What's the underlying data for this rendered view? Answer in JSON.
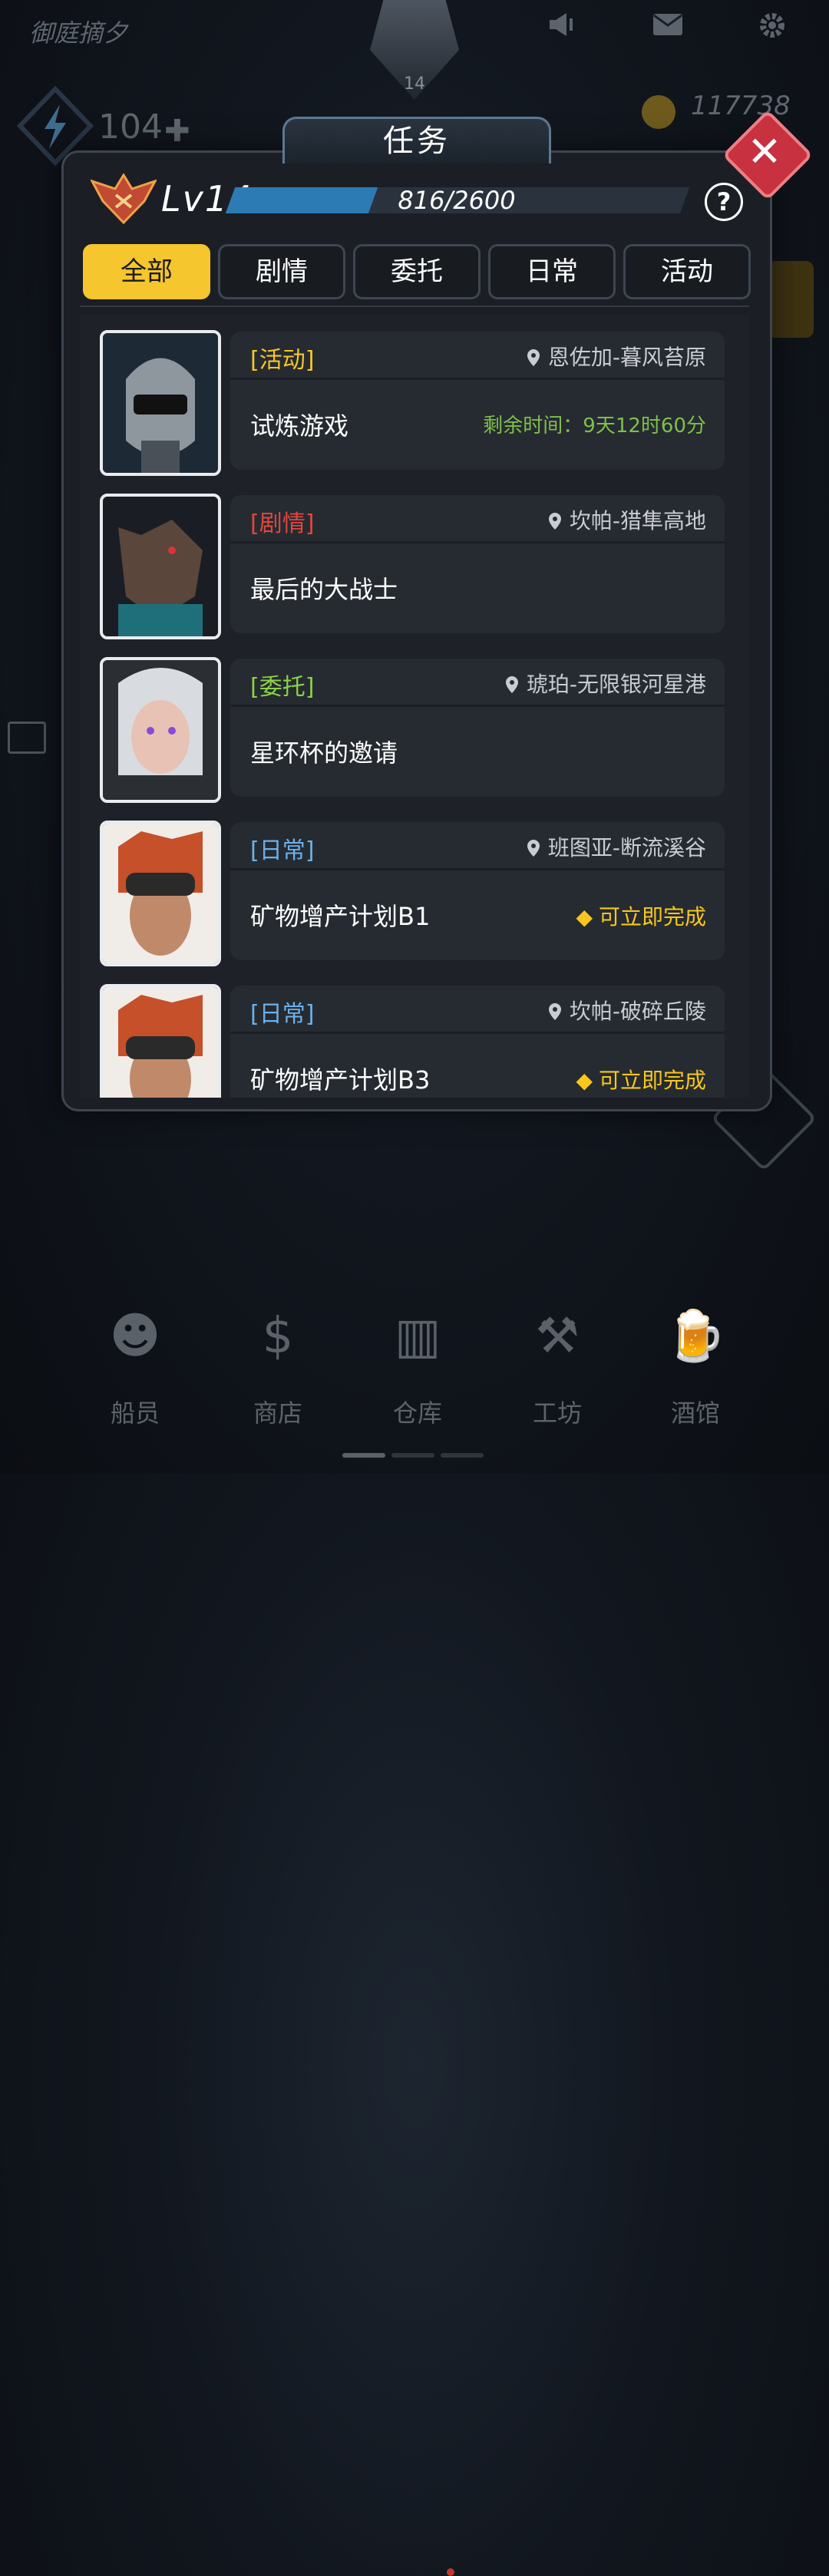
{
  "hud": {
    "player_name": "御庭摘夕",
    "player_level": "14",
    "energy": "104",
    "coins": "117738"
  },
  "panel": {
    "title": "任务",
    "level_label": "Lv14",
    "xp_text": "816/2600",
    "xp_fraction": 0.314,
    "help_label": "?",
    "close_label": "✕"
  },
  "tabs": [
    "全部",
    "剧情",
    "委托",
    "日常",
    "活动"
  ],
  "active_tab": 0,
  "quests": [
    {
      "tag": "[活动]",
      "tag_type": "act",
      "location": "恩佐加-暮风苔原",
      "name": "试炼游戏",
      "side": "剩余时间：9天12时60分",
      "side_type": "timer",
      "portrait": "robot-helmet"
    },
    {
      "tag": "[剧情]",
      "tag_type": "story",
      "location": "坎帕-猎隼高地",
      "name": "最后的大战士",
      "side": "",
      "side_type": "",
      "portrait": "wolf"
    },
    {
      "tag": "[委托]",
      "tag_type": "comm",
      "location": "琥珀-无限银河星港",
      "name": "星环杯的邀请",
      "side": "",
      "side_type": "",
      "portrait": "silver-hair-girl"
    },
    {
      "tag": "[日常]",
      "tag_type": "daily",
      "location": "班图亚-断流溪谷",
      "name": "矿物增产计划B1",
      "side": "可立即完成",
      "side_type": "done",
      "portrait": "goggles-redhead"
    },
    {
      "tag": "[日常]",
      "tag_type": "daily",
      "location": "坎帕-破碎丘陵",
      "name": "矿物增产计划B3",
      "side": "可立即完成",
      "side_type": "done",
      "portrait": "goggles-redhead"
    }
  ],
  "dock": [
    "船员",
    "商店",
    "仓库",
    "工坊",
    "酒馆"
  ],
  "colors": {
    "accent_yellow": "#f5c62d",
    "xp_blue": "#2d7bb5",
    "close_red": "#c8313f"
  }
}
